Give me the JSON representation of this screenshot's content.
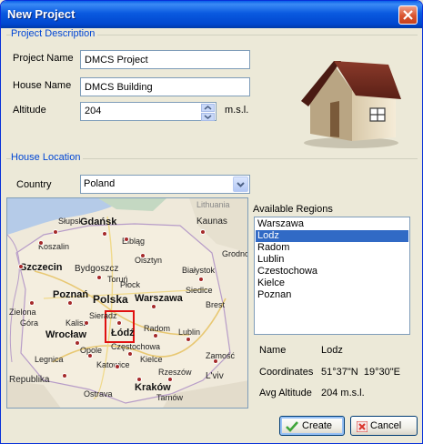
{
  "window": {
    "title": "New Project"
  },
  "project": {
    "group_label": "Project Description",
    "name_label": "Project Name",
    "name_value": "DMCS Project",
    "house_label": "House Name",
    "house_value": "DMCS Building",
    "altitude_label": "Altitude",
    "altitude_value": "204",
    "altitude_unit": "m.s.l."
  },
  "location": {
    "group_label": "House Location",
    "country_label": "Country",
    "country_value": "Poland"
  },
  "map": {
    "labels": [
      "Gdańsk",
      "Kaunas",
      "Słupsk",
      "Elbląg",
      "Koszalin",
      "Olsztyn",
      "Szczecin",
      "Bydgoszcz",
      "Białystok",
      "Grodno",
      "Poznań",
      "Polska",
      "Warszawa",
      "Zielona",
      "Kalisz",
      "Brest",
      "Wrocław",
      "Łódź",
      "Radom",
      "Lublin",
      "Opole",
      "Częstochowa",
      "Katowice",
      "Rzeszów",
      "L'viv",
      "Republika",
      "Kraków",
      "Ostrava",
      "Kielce",
      "Góra",
      "Legnica",
      "Toruń",
      "Płock",
      "Siedlce",
      "Tarnów",
      "Lithuania",
      "Sieradz",
      "Zamość"
    ],
    "selected_marker_label": "Łódź"
  },
  "regions": {
    "label": "Available Regions",
    "items": [
      "Warszawa",
      "Lodz",
      "Radom",
      "Lublin",
      "Czestochowa",
      "Kielce",
      "Poznan"
    ],
    "selected_index": 1
  },
  "details": {
    "name_label": "Name",
    "name_value": "Lodz",
    "coords_label": "Coordinates",
    "coords_value": "51°37\"N  19°30\"E",
    "altitude_label": "Avg Altitude",
    "altitude_value": "204 m.s.l."
  },
  "buttons": {
    "create": "Create",
    "cancel": "Cancel"
  },
  "colors": {
    "titlebar": "#0a5ae0",
    "group_label": "#0046d5",
    "selection": "#316ac5",
    "marker": "#a52a2a",
    "create_icon": "#3fa53a",
    "cancel_icon": "#d9332a"
  },
  "icons": {
    "close": "close-icon",
    "house": "house-icon",
    "create": "check-icon",
    "cancel": "x-icon"
  }
}
